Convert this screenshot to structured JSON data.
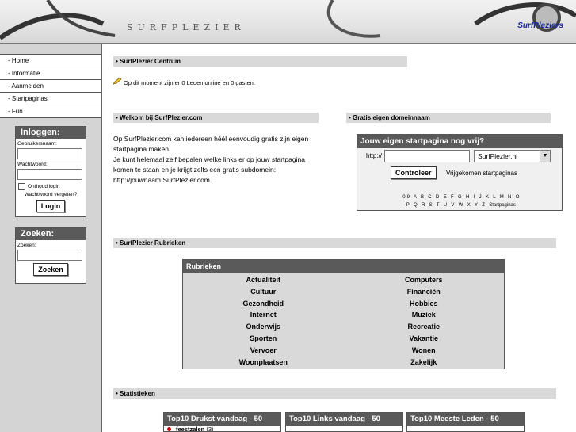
{
  "header": {
    "logo_text": "SURFPLEZIER",
    "brand": "SurfPleziers"
  },
  "nav": {
    "items": [
      "- Home",
      "- Informatie",
      "- Aanmelden",
      "- Startpaginas",
      "- Fun"
    ]
  },
  "login": {
    "title": "Inloggen:",
    "username_label": "Gebruikersnaam:",
    "password_label": "Wachtwoord:",
    "remember_label": "Onthoud login",
    "forgot_label": "Wachtwoord vergeten?",
    "button_label": "Login"
  },
  "search": {
    "title": "Zoeken:",
    "label": "Zoeken:",
    "button_label": "Zoeken"
  },
  "centrum": {
    "title": "• SurfPlezier Centrum",
    "online_text": "Op dit moment zijn er 0 Leden online en 0 gasten."
  },
  "welcome": {
    "title": "• Welkom bij SurfPlezier.com",
    "lines": [
      "Op SurfPlezier.com kan iedereen héél eenvoudig gratis zijn eigen",
      "startpagina maken.",
      "Je kunt helemaal zelf bepalen welke links er op jouw startpagina",
      "komen te staan en je krijgt zelfs een gratis subdomein:",
      "http://jouwnaam.SurfPlezier.com."
    ]
  },
  "domain": {
    "title": "• Gratis eigen domeinnaam",
    "panel_title": "Jouw eigen startpagina nog vrij?",
    "prefix": "http://",
    "select_value": "SurfPlezier.nl",
    "button_label": "Controleer",
    "free_link": "Vrijgekomen startpaginas",
    "letters_line1": "- 0-9 - A - B - C - D - E - F - G - H - I - J - K - L - M - N - O",
    "letters_line2": "- P - Q - R - S - T - U - V - W - X - Y - Z - Startpaginas"
  },
  "rubrieken": {
    "title": "• SurfPlezier Rubrieken",
    "panel_title": "Rubrieken",
    "items": [
      "Actualiteit",
      "Computers",
      "Cultuur",
      "Financiën",
      "Gezondheid",
      "Hobbies",
      "Internet",
      "Muziek",
      "Onderwijs",
      "Recreatie",
      "Sporten",
      "Vakantie",
      "Vervoer",
      "Wonen",
      "Woonplaatsen",
      "Zakelijk"
    ]
  },
  "stats": {
    "title": "• Statistieken",
    "boxes": [
      {
        "title": "Top10 Drukst vandaag - ",
        "link": "50",
        "row_name": "feestzalen",
        "row_count": "(3)"
      },
      {
        "title": "Top10 Links vandaag - ",
        "link": "50"
      },
      {
        "title": "Top10 Meeste Leden - ",
        "link": "50"
      }
    ]
  },
  "colors": {
    "panel_header": "#5a5a5a",
    "sidebar_bg": "#d4d4d4",
    "section_bar": "#d9d9d9",
    "brand": "#1a2a9a"
  }
}
